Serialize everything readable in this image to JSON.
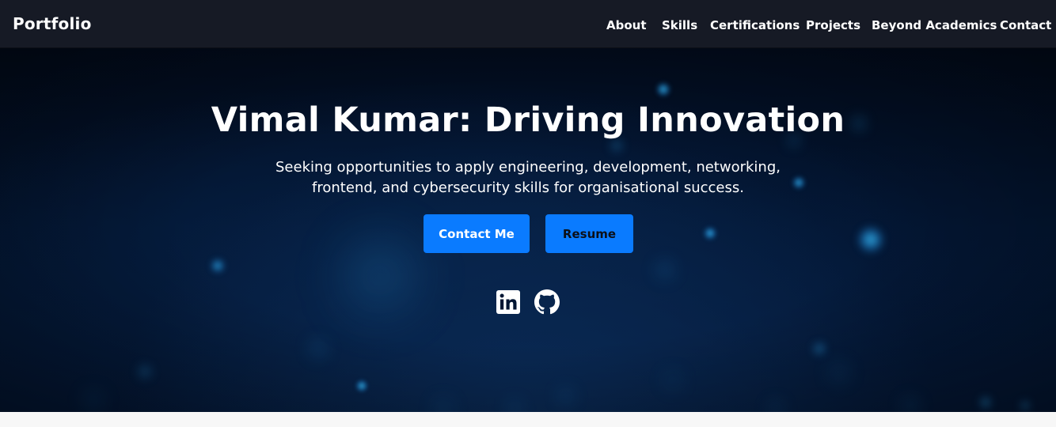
{
  "navbar": {
    "brand": "Portfolio",
    "links": [
      {
        "label": "About"
      },
      {
        "label": "Skills"
      },
      {
        "label": "Certifications"
      },
      {
        "label": "Projects"
      },
      {
        "label": "Beyond Academics"
      },
      {
        "label": "Contact"
      }
    ]
  },
  "hero": {
    "title": "Vimal Kumar: Driving Innovation",
    "subtitle_line1": "Seeking opportunities to apply engineering, development, networking,",
    "subtitle_line2": "frontend, and cybersecurity skills for organisational success.",
    "buttons": {
      "contact_label": "Contact Me",
      "resume_label": "Resume"
    },
    "social_icons": [
      "linkedin-icon",
      "github-icon"
    ]
  },
  "colors": {
    "nav_bg": "#161a25",
    "hero_bg": "#031633",
    "accent": "#0a7bff",
    "text": "#ffffff"
  }
}
